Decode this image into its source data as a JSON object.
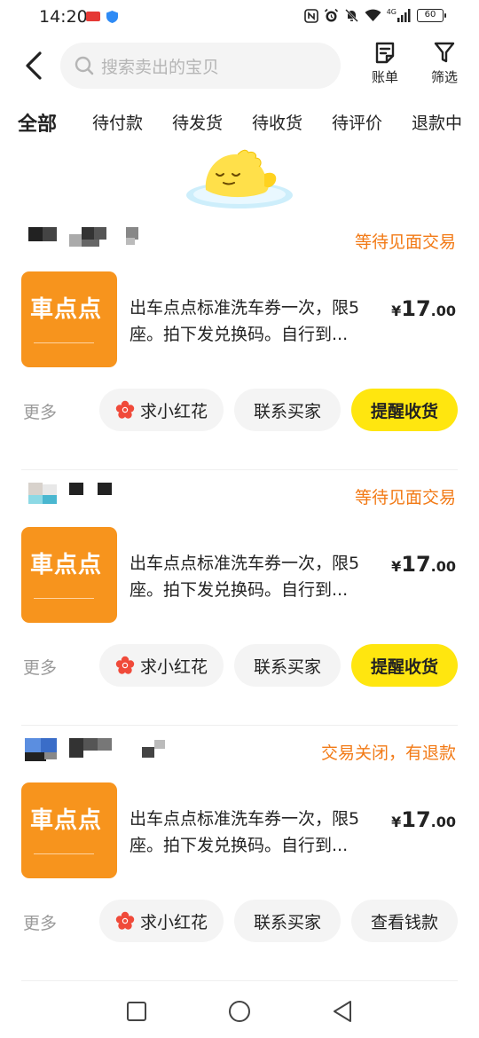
{
  "status_bar": {
    "time": "14:20",
    "network": "4G",
    "battery": "60"
  },
  "header": {
    "search_placeholder": "搜索卖出的宝贝",
    "bill_label": "账单",
    "filter_label": "筛选"
  },
  "tabs": [
    {
      "label": "全部",
      "active": true
    },
    {
      "label": "待付款",
      "active": false
    },
    {
      "label": "待发货",
      "active": false
    },
    {
      "label": "待收货",
      "active": false
    },
    {
      "label": "待评价",
      "active": false
    },
    {
      "label": "退款中",
      "active": false
    }
  ],
  "orders": [
    {
      "status": "等待见面交易",
      "brand": "車点点",
      "title": "出车点点标准洗车券一次，限5座。拍下发兑换码。自行到...",
      "price_currency": "¥",
      "price_int": "17",
      "price_dec": ".00",
      "more": "更多",
      "btn_flower": "求小红花",
      "btn_contact": "联系买家",
      "btn_action": "提醒收货",
      "action_primary": true
    },
    {
      "status": "等待见面交易",
      "brand": "車点点",
      "title": "出车点点标准洗车券一次，限5座。拍下发兑换码。自行到...",
      "price_currency": "¥",
      "price_int": "17",
      "price_dec": ".00",
      "more": "更多",
      "btn_flower": "求小红花",
      "btn_contact": "联系买家",
      "btn_action": "提醒收货",
      "action_primary": true
    },
    {
      "status": "交易关闭，有退款",
      "brand": "車点点",
      "title": "出车点点标准洗车券一次，限5座。拍下发兑换码。自行到...",
      "price_currency": "¥",
      "price_int": "17",
      "price_dec": ".00",
      "more": "更多",
      "btn_flower": "求小红花",
      "btn_contact": "联系买家",
      "btn_action": "查看钱款",
      "action_primary": false
    }
  ],
  "colors": {
    "accent_yellow": "#ffe60f",
    "status_orange": "#f27a16",
    "thumb_orange": "#f7941d",
    "flower_red": "#f04a3a"
  },
  "icons": {
    "back": "chevron-left-icon",
    "search": "search-icon",
    "bill": "bill-icon",
    "filter": "filter-icon",
    "flower": "flower-icon",
    "nav_recent": "square-icon",
    "nav_home": "circle-icon",
    "nav_back": "triangle-back-icon"
  }
}
